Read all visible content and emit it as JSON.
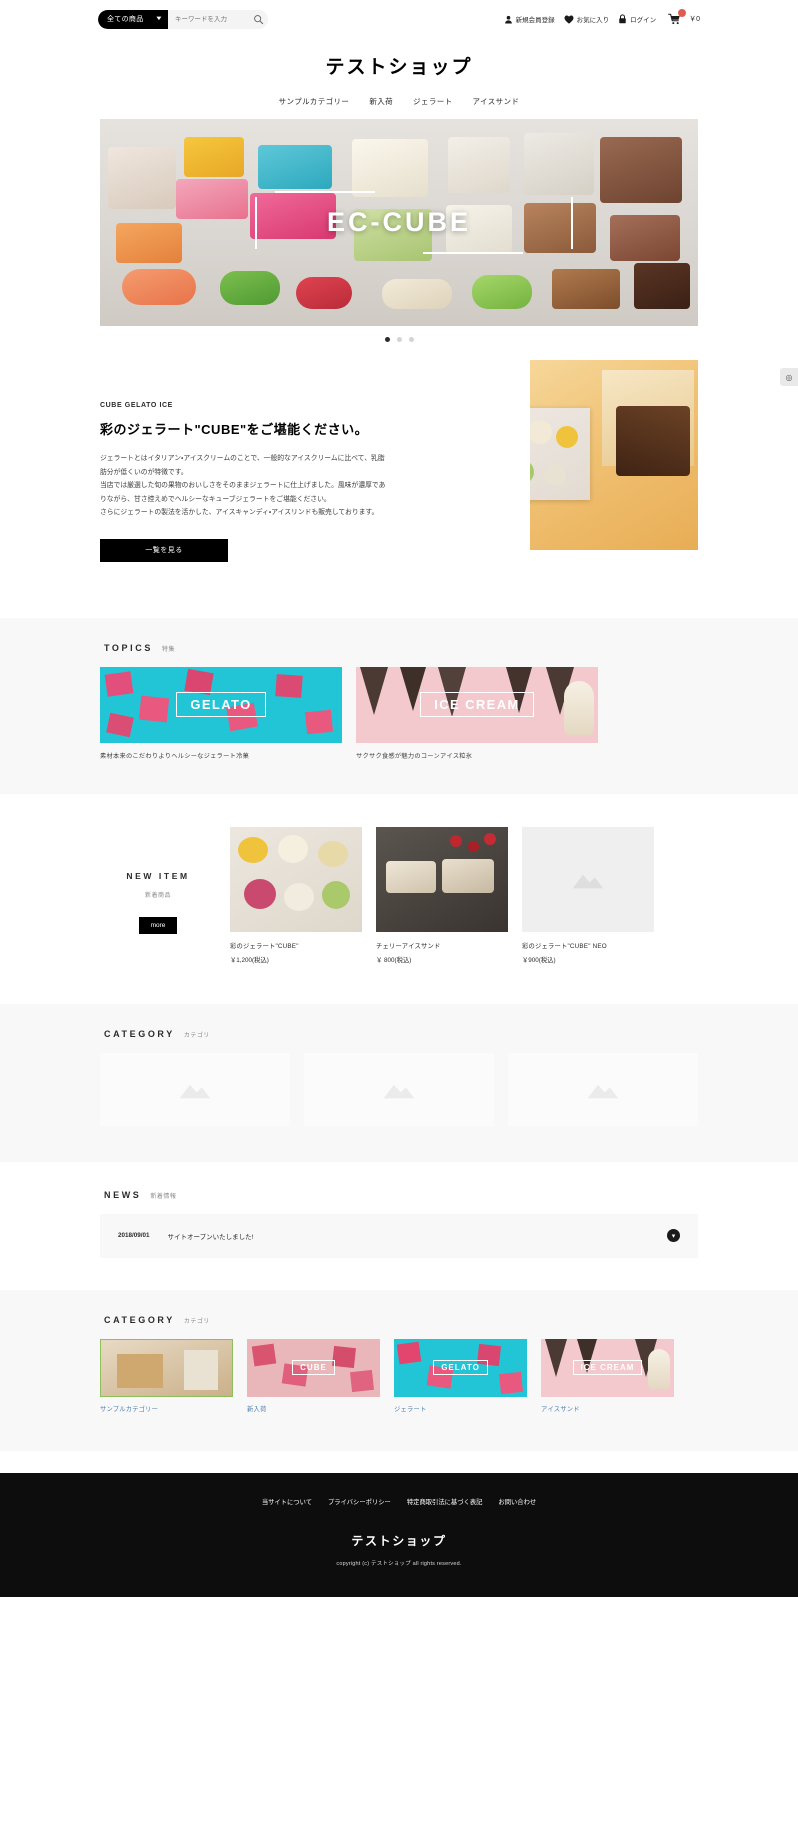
{
  "header": {
    "search": {
      "category_selected": "全ての商品",
      "placeholder": "キーワードを入力",
      "value": "",
      "search_icon": "search-icon",
      "caret_icon": "chevron-down-icon"
    },
    "links": [
      {
        "label": "新規会員登録",
        "icon": "user-icon"
      },
      {
        "label": "お気に入り",
        "icon": "heart-icon"
      },
      {
        "label": "ログイン",
        "icon": "lock-icon"
      }
    ],
    "cart": {
      "icon": "cart-icon",
      "count": "￥0",
      "badge_color": "#de5d50"
    }
  },
  "shop": {
    "title": "テストショップ"
  },
  "nav": {
    "items": [
      {
        "label": "サンプルカテゴリー"
      },
      {
        "label": "新入荷"
      },
      {
        "label": "ジェラート"
      },
      {
        "label": "アイスサンド"
      }
    ]
  },
  "hero": {
    "logo_text": "EC-CUBE",
    "slides_total": 3,
    "active_slide": 1
  },
  "about": {
    "eyebrow": "CUBE GELATO ICE",
    "heading": "彩のジェラート\"CUBE\"をご堪能ください。",
    "body": "ジェラートとはイタリアン・アイスクリームのことで、一般的なアイスクリームに比べて、乳脂肪分が低くいのが特徴です。\n当店では厳選した旬の果物のおいしさをそのままジェラートに仕上げました。風味が濃厚でありながら、甘さ控えめでヘルシーなキューブジェラートをご堪能ください。\nさらにジェラートの製法を活かした、アイスキャンディ・アイスリンドも販売しております。",
    "button_label": "一覧を見る"
  },
  "topics": {
    "title_en": "TOPICS",
    "title_ja": "特集",
    "cards": [
      {
        "banner_label": "GELATO",
        "caption": "素材本来のこだわりよりヘルシーなジェラート冷菓",
        "color": "#21c5d6"
      },
      {
        "banner_label": "ICE CREAM",
        "caption": "サクサク食感が魅力のコーンアイス粒氷",
        "color": "#f3c9ce"
      }
    ]
  },
  "new_item": {
    "title_en": "NEW ITEM",
    "title_ja": "新着商品",
    "more_label": "more",
    "products": [
      {
        "name": "彩のジェラート\"CUBE\"",
        "price": "￥1,200(税込)",
        "has_photo": true
      },
      {
        "name": "チェリーアイスサンド",
        "price": "￥ 800(税込)",
        "has_photo": true
      },
      {
        "name": "彩のジェラート\"CUBE\" NEO",
        "price": "￥900(税込)",
        "has_photo": false
      }
    ]
  },
  "category_placeholder": {
    "title_en": "CATEGORY",
    "title_ja": "カテゴリ",
    "items": [
      {
        "label": ""
      },
      {
        "label": ""
      },
      {
        "label": ""
      }
    ]
  },
  "news": {
    "title_en": "NEWS",
    "title_ja": "新着情報",
    "entries": [
      {
        "date": "2018/09/01",
        "text": "サイトオープンいたしました!",
        "toggle_icon": "chevron-down-circle-icon"
      }
    ]
  },
  "category_photos": {
    "title_en": "CATEGORY",
    "title_ja": "カテゴリ",
    "items": [
      {
        "label": "サンプルカテゴリー",
        "badge": "",
        "color": "#d8c6ae"
      },
      {
        "label": "新入荷",
        "badge": "CUBE",
        "color": "#e9b7b9"
      },
      {
        "label": "ジェラート",
        "badge": "GELATO",
        "color": "#21c5d6"
      },
      {
        "label": "アイスサンド",
        "badge": "ICE CREAM",
        "color": "#f3c9ce"
      }
    ]
  },
  "footer": {
    "links": [
      {
        "label": "当サイトについて"
      },
      {
        "label": "プライバシーポリシー"
      },
      {
        "label": "特定商取引法に基づく表記"
      },
      {
        "label": "お問い合わせ"
      }
    ],
    "title": "テストショップ",
    "copyright": "copyright (c) テストショップ all rights reserved."
  },
  "side_tab": {
    "icon": "chat-icon",
    "glyph": "◎"
  }
}
